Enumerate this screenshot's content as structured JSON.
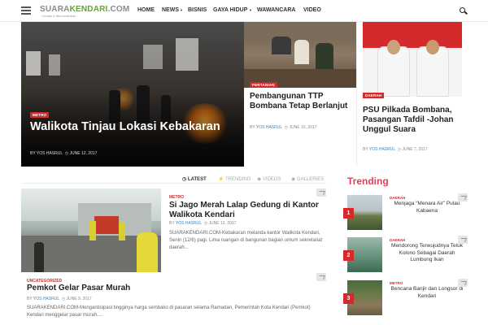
{
  "header": {
    "logo_main": "SUARA",
    "logo_accent": "KENDARI",
    "logo_tld": ".COM",
    "logo_tagline": "Cerdas & Mencerahkan",
    "nav": [
      "HOME",
      "NEWS",
      "BISNIS",
      "GAYA HIDUP",
      "WAWANCARA",
      "VIDEO"
    ]
  },
  "hero": {
    "category": "METRO",
    "title": "Walikota Tinjau Lokasi Kebakaran",
    "author_prefix": "BY",
    "author": "YOS HASRUL",
    "date": "JUNE 12, 2017"
  },
  "card2": {
    "category": "PERTANIAN",
    "title": "Pembangunan TTP Bombana Tetap Berlanjut",
    "author_prefix": "BY",
    "author": "YOS HASRUL",
    "date": "JUNE 10, 2017"
  },
  "card3": {
    "category": "DAERAH",
    "title": "PSU Pilkada Bombana, Pasangan Tafdil -Johan Unggul Suara",
    "author_prefix": "BY",
    "author": "YOS HASRUL",
    "date": "JUNE 7, 2017"
  },
  "tabs": [
    "LATEST",
    "TRENDING",
    "VIDEOS",
    "GALLERIES"
  ],
  "articles": [
    {
      "category": "METRO",
      "title": "Si Jago Merah Lalap Gedung di Kantor Walikota Kendari",
      "author_prefix": "BY",
      "author": "YOS HASRUL",
      "date": "JUNE 12, 2017",
      "excerpt": "SUARAKENDARI.COM-Kebakaran melanda kantor Walikota Kendari, Senin (12/6) pagi. Lima ruangan di bangunan bagian umum sekretariat daerah..."
    },
    {
      "category": "UNCATEGORIZED",
      "title": "Pemkot Gelar Pasar Murah",
      "author_prefix": "BY",
      "author": "YOS HASRUL",
      "date": "JUNE 9, 2017",
      "excerpt": "SUARAKENDARI.COM-Mengantisipasi tingginya harga sembako di pasaran selama Ramadan, Pemerintah Kota Kendari (Pemkot) Kendari menggelar pasar murah...."
    }
  ],
  "trending": {
    "title": "Trending",
    "items": [
      {
        "num": "1",
        "category": "DAERAH",
        "title": "Menjaga “Menara Air” Pulau Kabaena"
      },
      {
        "num": "2",
        "category": "DAERAH",
        "title": "Mendorong Terwujudnya Teluk Kolono Sebagai Daerah Lumbung Ikan"
      },
      {
        "num": "3",
        "category": "METRO",
        "title": "Bencana Banjir dan Longsor di Kendari"
      }
    ]
  },
  "colors": {
    "accent": "#d42a2a",
    "logo_green": "#5fa826",
    "trending": "#e0405a"
  }
}
